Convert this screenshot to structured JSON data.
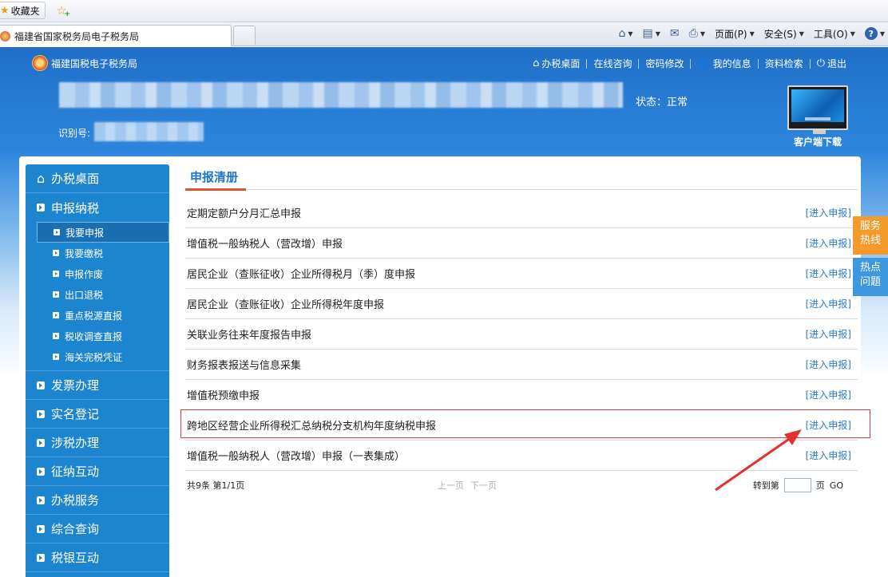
{
  "browser": {
    "favorites_label": "收藏夹",
    "tab_title": "福建省国家税务局电子税务局",
    "cmd": {
      "page": "页面(P)",
      "safety": "安全(S)",
      "tools": "工具(O)",
      "help": "?"
    }
  },
  "site": {
    "logo_text": "福建国税电子税务局",
    "nav": [
      "办税桌面",
      "在线咨询",
      "密码修改",
      "我的信息",
      "资料检索",
      "退出"
    ],
    "status": "状态：正常",
    "id_label": "识别号:",
    "client_download": "客户端下载"
  },
  "sidebar": {
    "home": "办税桌面",
    "declare": "申报纳税",
    "sub_items": [
      "我要申报",
      "我要缴税",
      "申报作废",
      "出口退税",
      "重点税源直报",
      "税收调查直报",
      "海关完税凭证"
    ],
    "items": [
      "发票办理",
      "实名登记",
      "涉税办理",
      "征纳互动",
      "办税服务",
      "综合查询",
      "税银互动"
    ]
  },
  "main": {
    "section_title": "申报清册",
    "link_label": "[进入申报]",
    "rows": [
      "定期定额户分月汇总申报",
      "增值税一般纳税人（营改增）申报",
      "居民企业（查账征收）企业所得税月（季）度申报",
      "居民企业（查账征收）企业所得税年度申报",
      "关联业务往来年度报告申报",
      "财务报表报送与信息采集",
      "增值税预缴申报",
      "跨地区经营企业所得税汇总纳税分支机构年度纳税申报",
      "增值税一般纳税人（营改增）申报（一表集成）"
    ],
    "pager": {
      "info": "共9条 第1/1页",
      "prev": "上一页",
      "next": "下一页",
      "goto": "转到第",
      "page_unit": "页",
      "go": "GO"
    }
  },
  "float": {
    "hotline": "服务热线",
    "hot_questions": "热点问题"
  },
  "colors": {
    "header_blue": "#1f6fc8",
    "sidebar_blue": "#1d85d0",
    "accent_orange": "#f39a2b",
    "highlight_red": "#e03a3a"
  }
}
